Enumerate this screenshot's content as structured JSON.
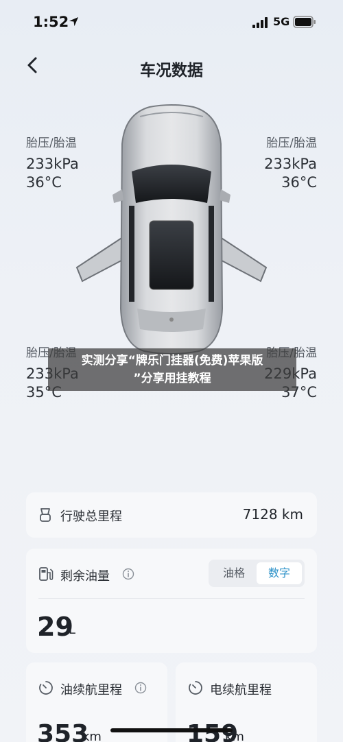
{
  "status_bar": {
    "time": "1:52",
    "network": "5G",
    "icons": [
      "location-arrow-icon",
      "signal-icon",
      "battery-icon"
    ]
  },
  "nav": {
    "title": "车况数据",
    "back_icon": "chevron-left-icon"
  },
  "tires": {
    "front_left": {
      "label": "胎压/胎温",
      "pressure": "233kPa",
      "temp": "36°C"
    },
    "front_right": {
      "label": "胎压/胎温",
      "pressure": "233kPa",
      "temp": "36°C"
    },
    "rear_left": {
      "label": "胎压/胎温",
      "pressure": "233kPa",
      "temp": "35°C"
    },
    "rear_right": {
      "label": "胎压/胎温",
      "pressure": "229kPa",
      "temp": "37°C"
    }
  },
  "watermark": {
    "line1": "实测分享“牌乐门挂器(免费)苹果版",
    "line2": "”分享用挂教程"
  },
  "odometer": {
    "label": "行驶总里程",
    "value": "7128 km",
    "icon": "odometer-icon"
  },
  "fuel": {
    "label": "剩余油量",
    "icon": "fuel-pump-icon",
    "info_icon": "info-icon",
    "tabs": [
      {
        "label": "油格",
        "active": false
      },
      {
        "label": "数字",
        "active": true
      }
    ],
    "value": "29",
    "unit": "L"
  },
  "range": {
    "fuel": {
      "label": "油续航里程",
      "value": "353",
      "unit": "km",
      "icon": "gauge-icon",
      "info_icon": "info-icon"
    },
    "electric": {
      "label": "电续航里程",
      "value": "159",
      "unit": "km",
      "icon": "gauge-icon"
    }
  },
  "colors": {
    "accent": "#2f93c9",
    "background": "#eef1f6",
    "card": "#f7f8fa"
  }
}
